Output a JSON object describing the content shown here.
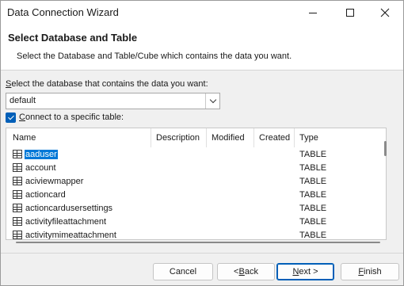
{
  "window": {
    "title": "Data Connection Wizard"
  },
  "header": {
    "title": "Select Database and Table",
    "description": "Select the Database and Table/Cube which contains the data you want."
  },
  "database": {
    "label_accel": "S",
    "label_rest": "elect the database that contains the data you want:",
    "selected": "default"
  },
  "specific_table": {
    "checked": true,
    "label_accel": "C",
    "label_rest": "onnect to a specific table:"
  },
  "table": {
    "columns": [
      "Name",
      "Description",
      "Modified",
      "Created",
      "Type"
    ],
    "rows": [
      {
        "name": "aaduser",
        "type": "TABLE",
        "selected": true
      },
      {
        "name": "account",
        "type": "TABLE"
      },
      {
        "name": "aciviewmapper",
        "type": "TABLE"
      },
      {
        "name": "actioncard",
        "type": "TABLE"
      },
      {
        "name": "actioncardusersettings",
        "type": "TABLE"
      },
      {
        "name": "activityfileattachment",
        "type": "TABLE"
      },
      {
        "name": "activitymimeattachment",
        "type": "TABLE"
      }
    ]
  },
  "buttons": {
    "cancel": "Cancel",
    "back_prefix": "< ",
    "back_accel": "B",
    "back_rest": "ack",
    "next_accel": "N",
    "next_rest": "ext >",
    "finish_accel": "F",
    "finish_rest": "inish"
  },
  "icons": {
    "minimize": "minimize-icon",
    "maximize": "maximize-icon",
    "close": "close-icon",
    "dropdown": "chevron-down-icon",
    "checkbox": "checkmark-icon",
    "table_row": "table-icon"
  },
  "colors": {
    "accent": "#005fb8",
    "selection": "#0078d7"
  }
}
